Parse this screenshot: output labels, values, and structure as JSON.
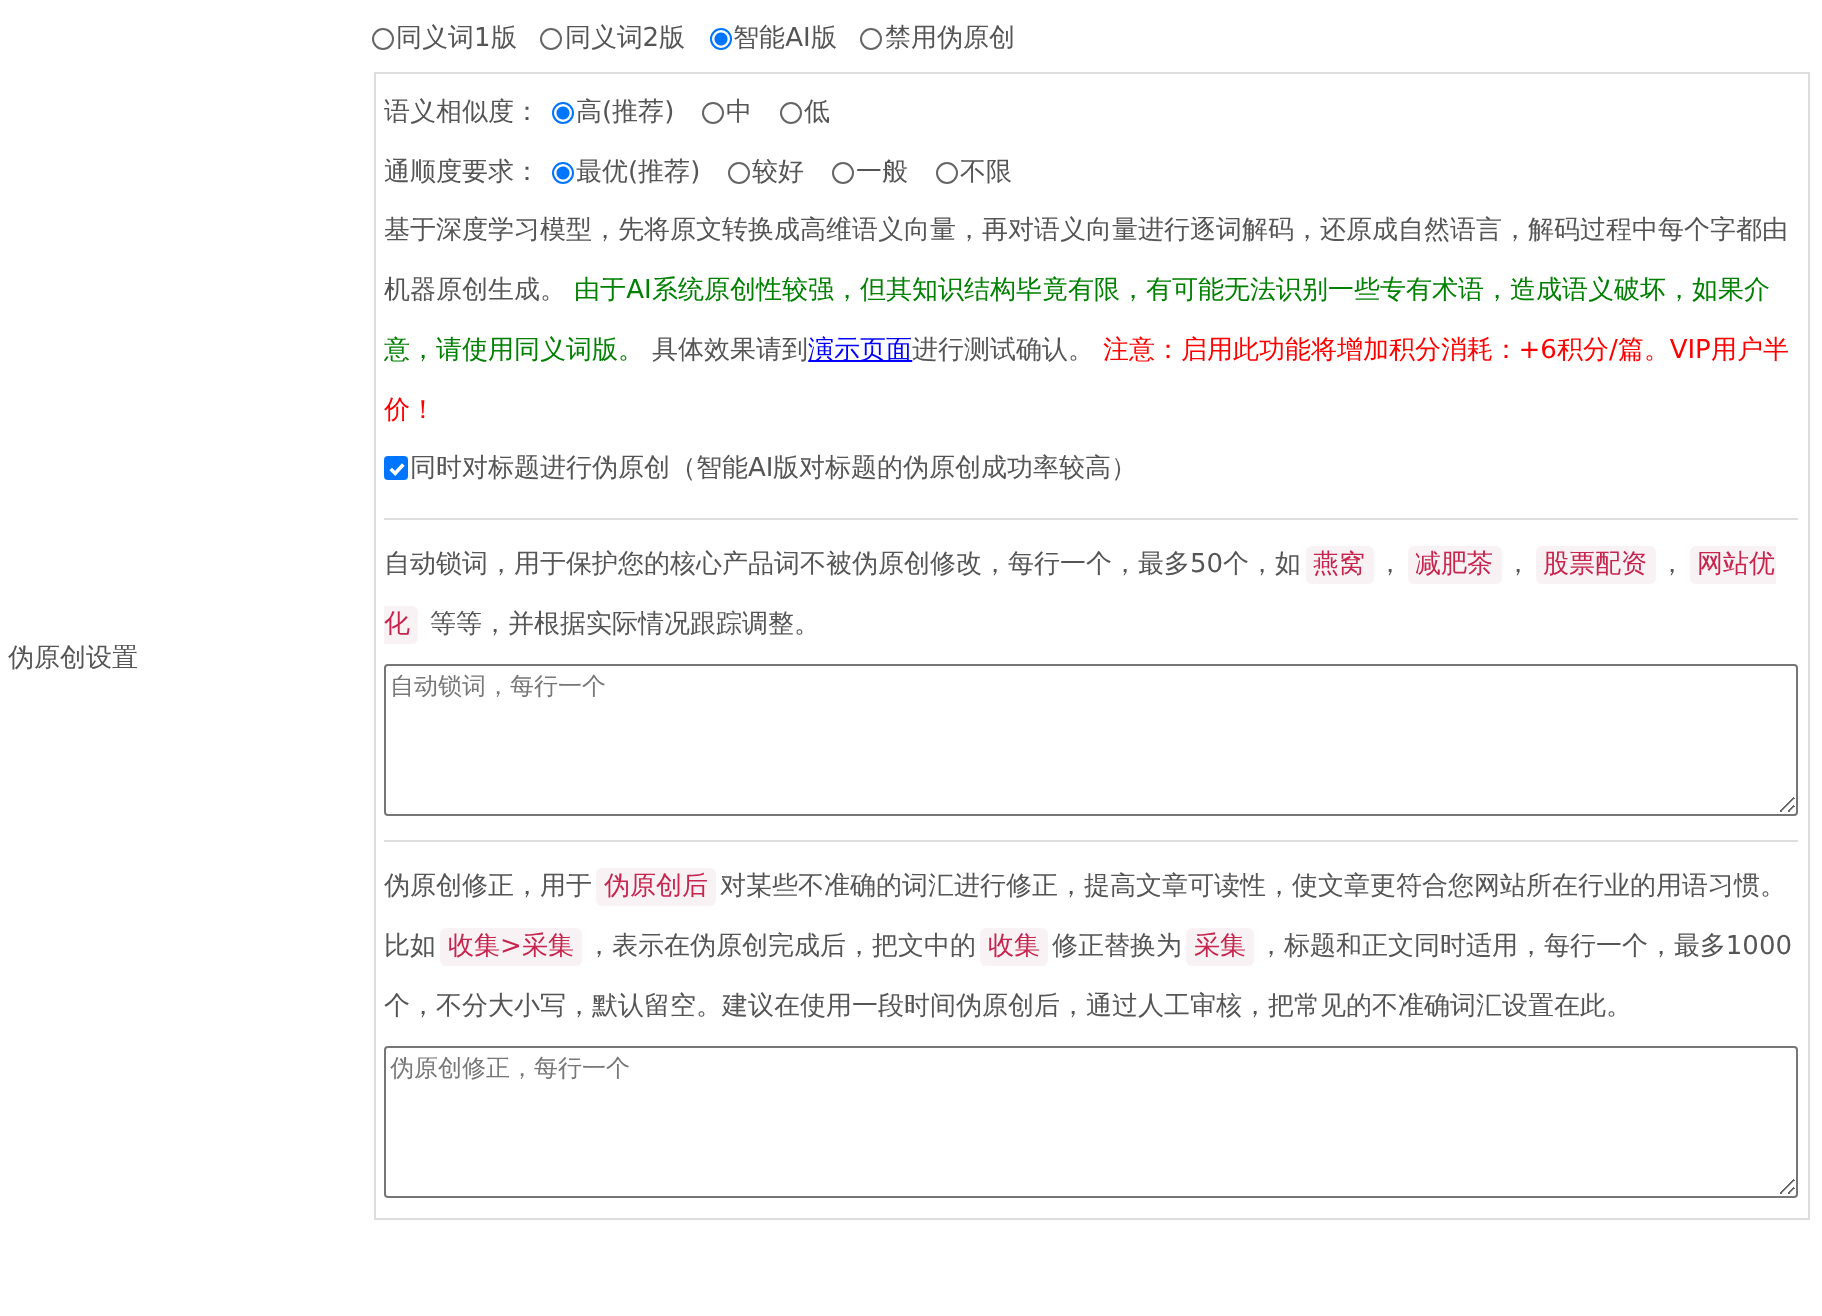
{
  "section_label": "伪原创设置",
  "modes": [
    {
      "label": "同义词1版",
      "selected": false
    },
    {
      "label": "同义词2版",
      "selected": false
    },
    {
      "label": "智能AI版",
      "selected": true
    },
    {
      "label": "禁用伪原创",
      "selected": false
    }
  ],
  "ai_options": [
    {
      "label": "语义相似度：",
      "choices": [
        {
          "label": "高(推荐)",
          "selected": true
        },
        {
          "label": "中",
          "selected": false
        },
        {
          "label": "低",
          "selected": false
        }
      ]
    },
    {
      "label": "通顺度要求：",
      "choices": [
        {
          "label": "最优(推荐)",
          "selected": true
        },
        {
          "label": "较好",
          "selected": false
        },
        {
          "label": "一般",
          "selected": false
        },
        {
          "label": "不限",
          "selected": false
        }
      ]
    }
  ],
  "ai_description": [
    {
      "kind": "plain",
      "text": "基于深度学习模型，先将原文转换成高维语义向量，再对语义向量进行逐词解码，还原成自然语言，解码过程中每个字都由机器原创生成。 "
    },
    {
      "kind": "green",
      "text": "由于AI系统原创性较强，但其知识结构毕竟有限，有可能无法识别一些专有术语，造成语义破坏，如果介意，请使用同义词版。"
    },
    {
      "kind": "plain",
      "text": " 具体效果请到"
    },
    {
      "kind": "link",
      "text": "演示页面"
    },
    {
      "kind": "plain",
      "text": "进行测试确认。 "
    },
    {
      "kind": "red",
      "text": "注意：启用此功能将增加积分消耗：+6积分/篇。VIP用户半价！"
    }
  ],
  "title_option": {
    "label": "同时对标题进行伪原创（智能AI版对标题的伪原创成功率较高）",
    "checked": true
  },
  "lock_words": {
    "description": [
      {
        "kind": "plain",
        "text": "自动锁词，用于保护您的核心产品词不被伪原创修改，每行一个，最多50个，如"
      },
      {
        "kind": "code",
        "text": "燕窝"
      },
      {
        "kind": "plain",
        "text": "，"
      },
      {
        "kind": "code",
        "text": "减肥茶"
      },
      {
        "kind": "plain",
        "text": "，"
      },
      {
        "kind": "code",
        "text": "股票配资"
      },
      {
        "kind": "plain",
        "text": "，"
      },
      {
        "kind": "code",
        "text": "网站优化"
      },
      {
        "kind": "plain",
        "text": " 等等，并根据实际情况跟踪调整。"
      }
    ],
    "placeholder": "自动锁词，每行一个"
  },
  "corrections": {
    "description": [
      {
        "kind": "plain",
        "text": "伪原创修正，用于"
      },
      {
        "kind": "code",
        "text": "伪原创后"
      },
      {
        "kind": "plain",
        "text": "对某些不准确的词汇进行修正，提高文章可读性，使文章更符合您网站所在行业的用语习惯。比如"
      },
      {
        "kind": "code",
        "text": "收集>采集"
      },
      {
        "kind": "plain",
        "text": "，表示在伪原创完成后，把文中的"
      },
      {
        "kind": "code",
        "text": "收集"
      },
      {
        "kind": "plain",
        "text": "修正替换为"
      },
      {
        "kind": "code",
        "text": "采集"
      },
      {
        "kind": "plain",
        "text": "，标题和正文同时适用，每行一个，最多1000个，不分大小写，默认留空。建议在使用一段时间伪原创后，通过人工审核，把常见的不准确词汇设置在此。"
      }
    ],
    "placeholder": "伪原创修正，每行一个"
  }
}
